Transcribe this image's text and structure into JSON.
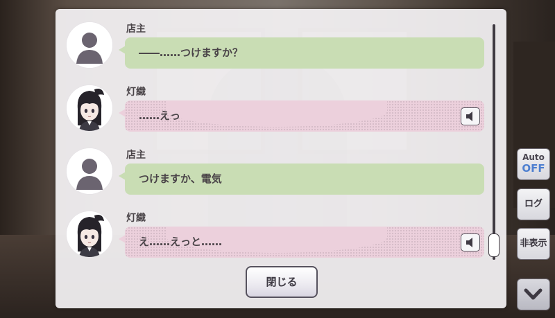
{
  "log": {
    "entries": [
      {
        "speaker": "店主",
        "text": "――……つけますか？",
        "avatar_icon": "silhouette-avatar-icon",
        "bubble_color": "#c9ddb4",
        "has_voice": false
      },
      {
        "speaker": "灯織",
        "text": "……えっ",
        "avatar_icon": "character-portrait-hiori-icon",
        "bubble_color": "#ecd0dc",
        "has_voice": true
      },
      {
        "speaker": "店主",
        "text": "つけますか、電気",
        "avatar_icon": "silhouette-avatar-icon",
        "bubble_color": "#c9ddb4",
        "has_voice": false
      },
      {
        "speaker": "灯織",
        "text": "え……えっと……",
        "avatar_icon": "character-portrait-hiori-icon",
        "bubble_color": "#ecd0dc",
        "has_voice": true
      }
    ],
    "close_label": "閉じる"
  },
  "side_menu": {
    "auto_label": "Auto",
    "auto_state": "OFF",
    "log_label": "ログ",
    "hide_label": "非表示",
    "scroll_icon": "chevron-down-icon"
  },
  "colors": {
    "accent_blue": "#4d7fd0",
    "panel_bg": "#f4f2f4"
  }
}
